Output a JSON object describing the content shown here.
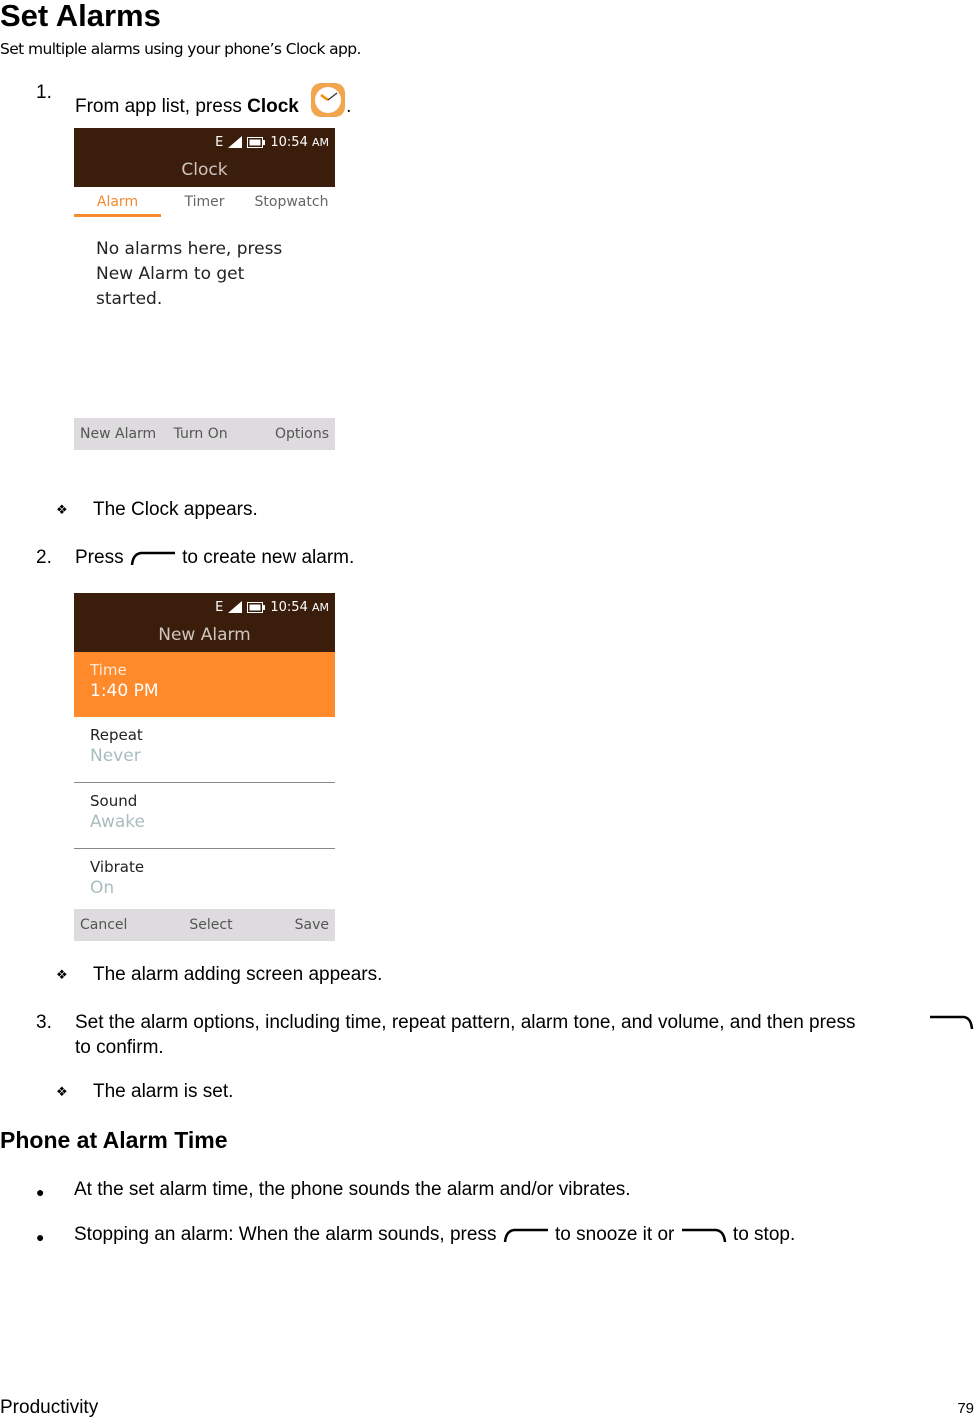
{
  "title": "Set Alarms",
  "intro": "Set multiple alarms using your phone’s Clock app.",
  "steps": [
    {
      "num": "1.",
      "text_before": "From app list, press ",
      "bold": "Clock",
      "text_after": ".",
      "result": "The Clock appears."
    },
    {
      "num": "2.",
      "text_before": "Press ",
      "text_after": " to create new alarm.",
      "result": "The alarm adding screen appears."
    },
    {
      "num": "3.",
      "text_line1": "Set the alarm options, including time, repeat pattern, alarm tone, and volume, and then press",
      "text_line2": "to confirm.",
      "result": "The alarm is set."
    }
  ],
  "screen1": {
    "status": {
      "network": "E",
      "time": "10:54",
      "ampm": "AM"
    },
    "title": "Clock",
    "tabs": [
      {
        "label": "Alarm",
        "active": true
      },
      {
        "label": "Timer"
      },
      {
        "label": "Stopwatch"
      }
    ],
    "empty_message": "No alarms here, press New Alarm to get started.",
    "softkeys": {
      "left": "New Alarm",
      "center": "Turn On",
      "right": "Options"
    }
  },
  "screen2": {
    "status": {
      "network": "E",
      "time": "10:54",
      "ampm": "AM"
    },
    "title": "New Alarm",
    "rows": [
      {
        "label": "Time",
        "value": "1:40 PM",
        "selected": true
      },
      {
        "label": "Repeat",
        "value": "Never"
      },
      {
        "label": "Sound",
        "value": "Awake"
      },
      {
        "label": "Vibrate",
        "value": "On"
      }
    ],
    "softkeys": {
      "left": "Cancel",
      "center": "Select",
      "right": "Save"
    }
  },
  "section2": {
    "title": "Phone at Alarm Time",
    "bullets": [
      {
        "text": "At the set alarm time, the phone sounds the alarm and/or vibrates."
      },
      {
        "text_before": "Stopping an alarm: When the alarm sounds, press ",
        "text_middle": " to snooze it or ",
        "text_after": " to stop."
      }
    ]
  },
  "footer": {
    "section": "Productivity",
    "page": "79"
  },
  "icons": {
    "bullet": "❖",
    "dot": "●"
  },
  "colors": {
    "accent": "#fe8a2c",
    "header": "#3b1d0b"
  }
}
